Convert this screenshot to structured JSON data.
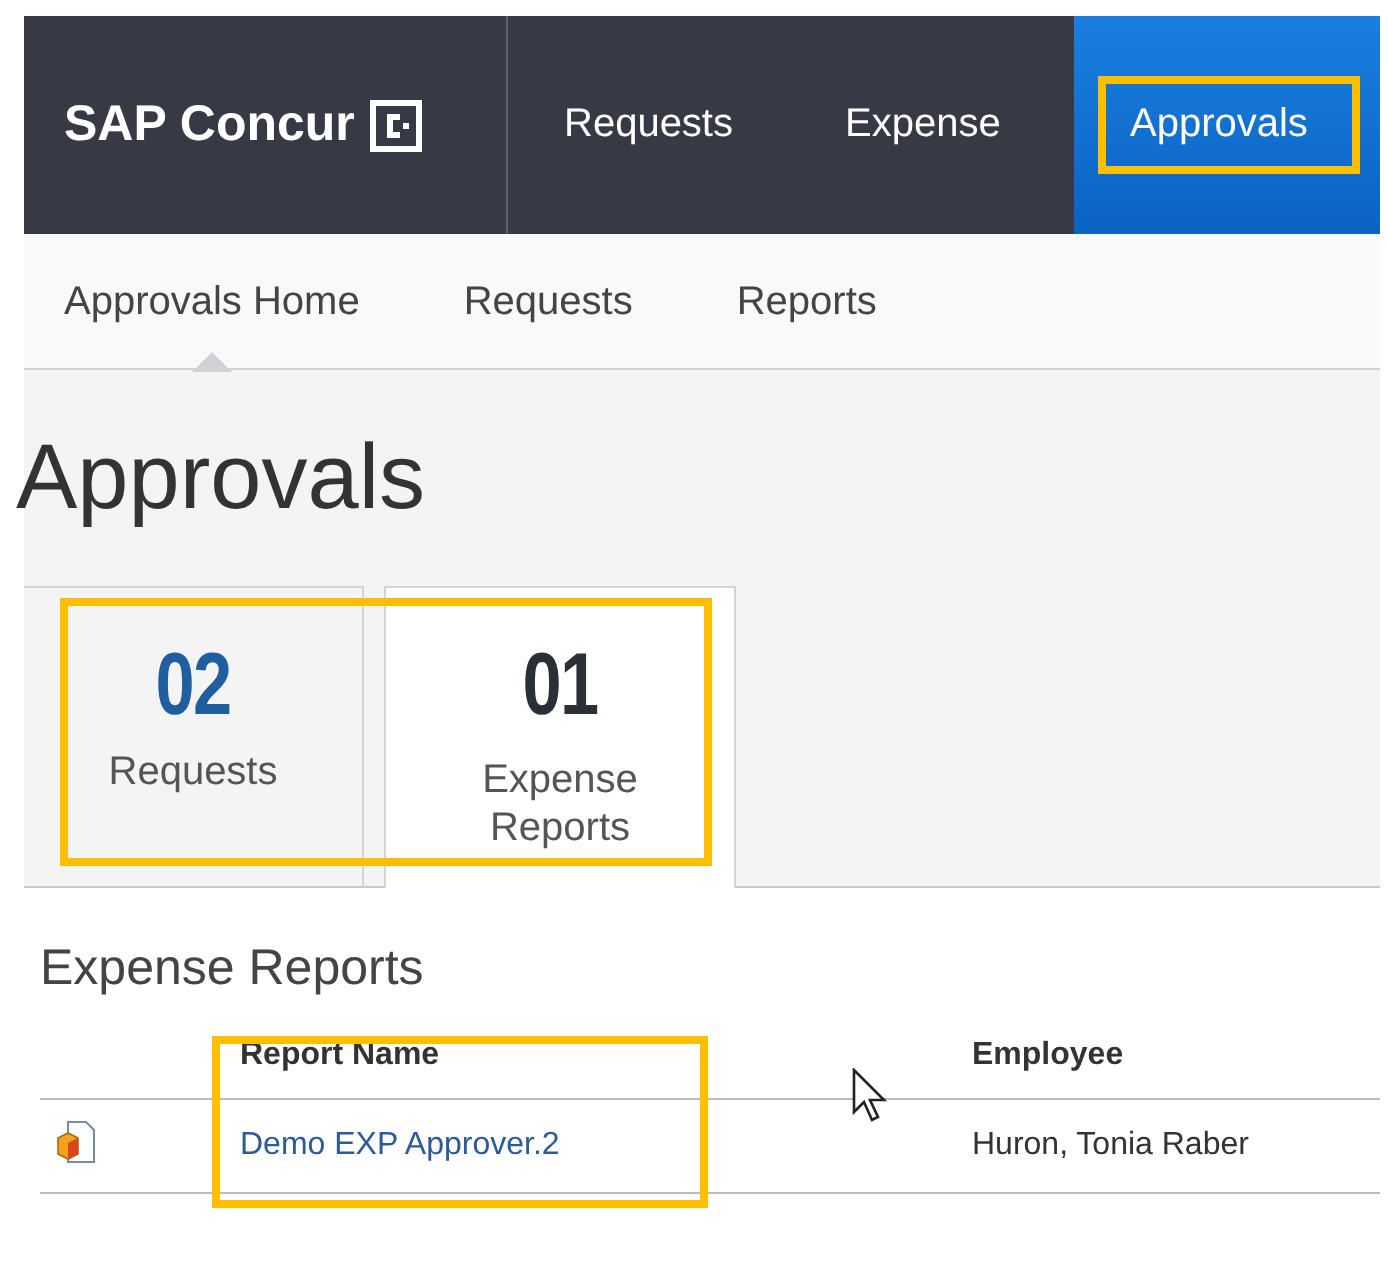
{
  "brand": {
    "name": "SAP Concur"
  },
  "nav": [
    {
      "label": "Requests",
      "selected": false,
      "highlighted": false
    },
    {
      "label": "Expense",
      "selected": false,
      "highlighted": false
    },
    {
      "label": "Approvals",
      "selected": true,
      "highlighted": true
    }
  ],
  "subnav": [
    {
      "label": "Approvals Home",
      "selected": true
    },
    {
      "label": "Requests",
      "selected": false
    },
    {
      "label": "Reports",
      "selected": false
    }
  ],
  "page_title": "Approvals",
  "tiles_highlighted": true,
  "tiles": [
    {
      "count": "02",
      "label": "Requests",
      "selected": false
    },
    {
      "count": "01",
      "label": "Expense Reports",
      "selected": true
    }
  ],
  "section_title": "Expense Reports",
  "report_name_highlighted": true,
  "table": {
    "columns": [
      {
        "label": "Report Name"
      },
      {
        "label": "Employee"
      }
    ],
    "rows": [
      {
        "report_name": "Demo EXP Approver.2",
        "employee": "Huron, Tonia Raber"
      }
    ]
  }
}
